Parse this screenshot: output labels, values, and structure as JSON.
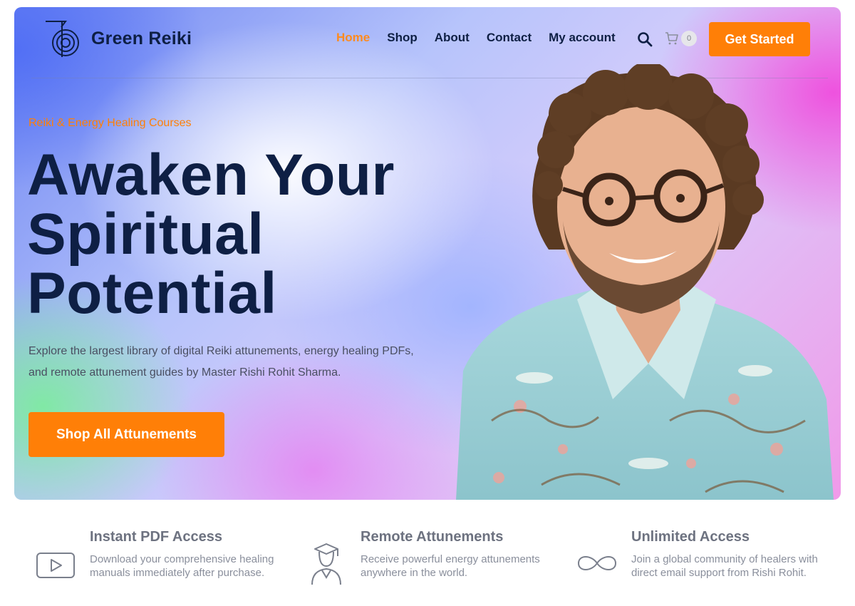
{
  "brand": {
    "name": "Green Reiki",
    "logo_icon": "reiki-spiral-icon"
  },
  "nav": {
    "items": [
      {
        "label": "Home",
        "active": true
      },
      {
        "label": "Shop",
        "active": false
      },
      {
        "label": "About",
        "active": false
      },
      {
        "label": "Contact",
        "active": false
      },
      {
        "label": "My account",
        "active": false
      }
    ],
    "search_icon": "search-icon",
    "cart_icon": "cart-icon",
    "cart_count": "0",
    "cta_label": "Get Started"
  },
  "hero": {
    "eyebrow": "Reiki & Energy Healing Courses",
    "headline_lines": [
      "Awaken Your",
      "Spiritual",
      "Potential"
    ],
    "description": "Explore the largest library of digital Reiki attunements, energy healing PDFs, and remote attunement guides by Master Rishi Rohit Sharma.",
    "cta_label": "Shop All Attunements"
  },
  "features": [
    {
      "icon": "play-video-icon",
      "title": "Instant PDF Access",
      "text": "Download your comprehensive healing manuals immediately after purchase."
    },
    {
      "icon": "graduate-icon",
      "title": "Remote Attunements",
      "text": "Receive powerful energy attunements anywhere in the world."
    },
    {
      "icon": "infinity-icon",
      "title": "Unlimited Access",
      "text": "Join a global community of healers with direct email support from Rishi Rohit."
    }
  ],
  "colors": {
    "accent": "#ff7f07",
    "heading": "#0e1f44",
    "body_text": "#4a4f62",
    "feature_title": "#6d7280"
  }
}
